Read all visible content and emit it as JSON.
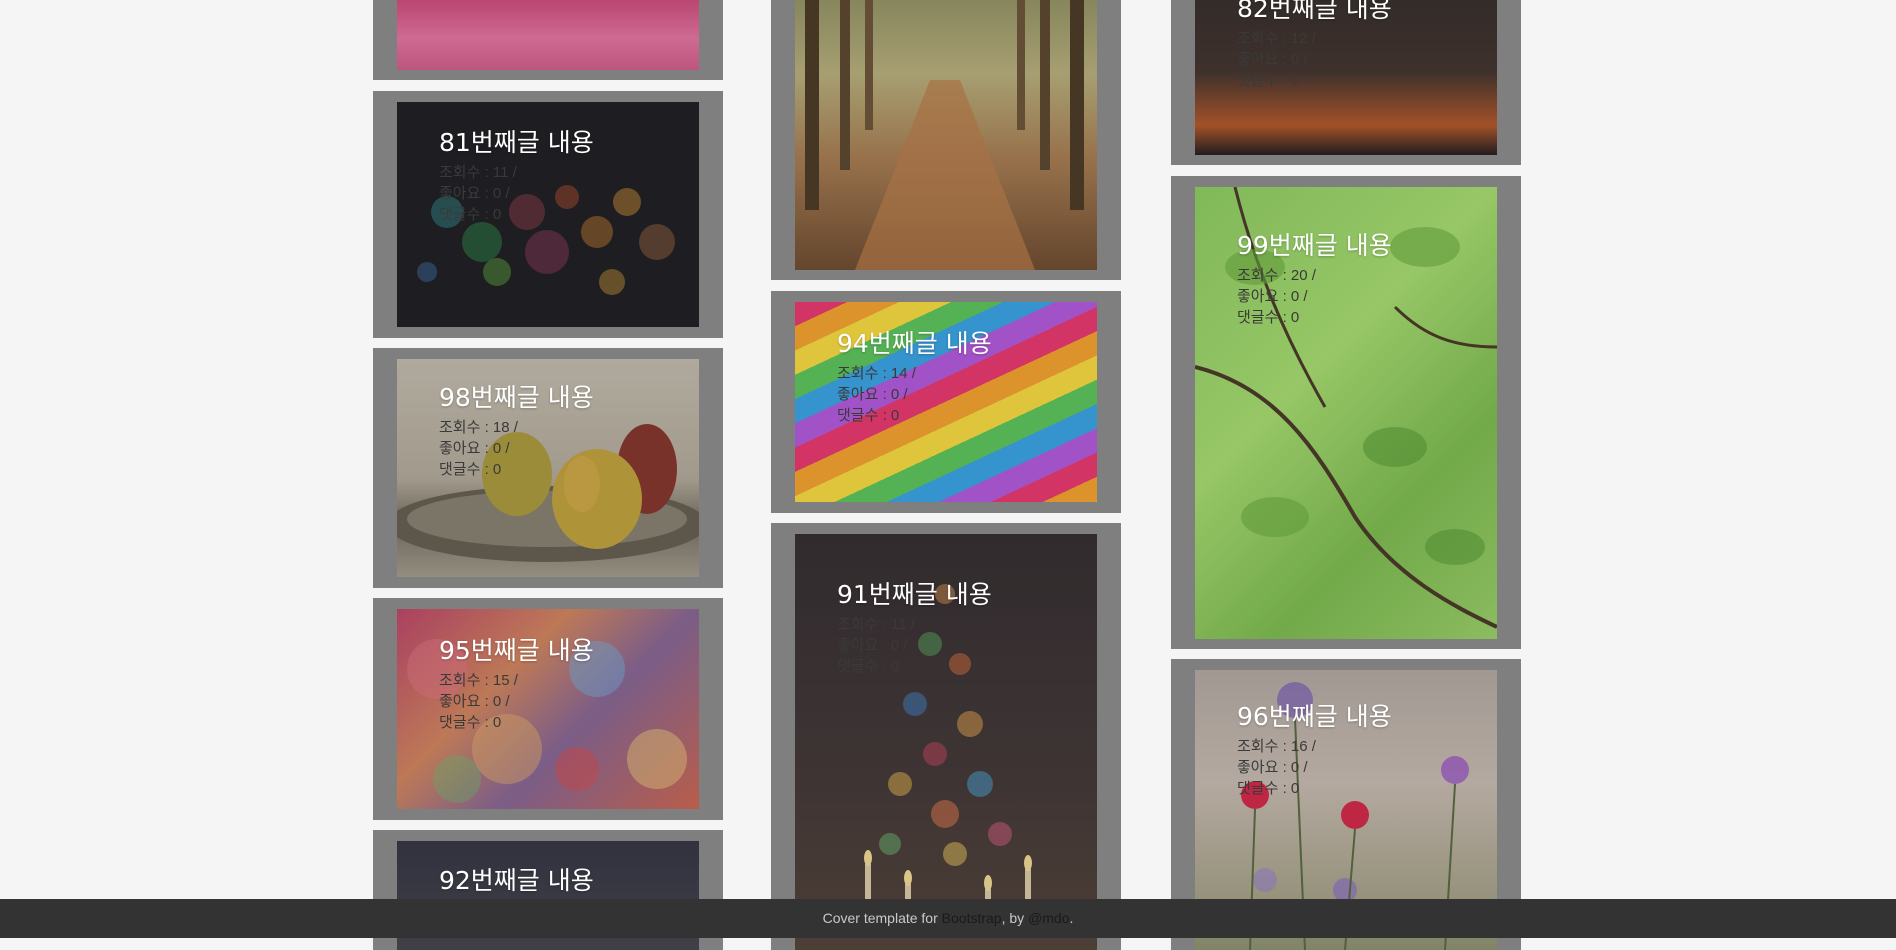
{
  "colors": {
    "page_background": "#f5f5f5",
    "card_border": "#7f7f7f",
    "title_text": "#ffffff",
    "stat_text": "#3a3a3a",
    "footer_background": "#333333",
    "footer_text": "#c9c9c9"
  },
  "posts": {
    "p81": {
      "title": "81번째글 내용",
      "views": "조회수 : 11 /",
      "likes": "좋아요 : 0 /",
      "comments": "댓글수 : 0"
    },
    "p98": {
      "title": "98번째글 내용",
      "views": "조회수 : 18 /",
      "likes": "좋아요 : 0 /",
      "comments": "댓글수 : 0"
    },
    "p95": {
      "title": "95번째글 내용",
      "views": "조회수 : 15 /",
      "likes": "좋아요 : 0 /",
      "comments": "댓글수 : 0"
    },
    "p92": {
      "title": "92번째글 내용"
    },
    "p94": {
      "title": "94번째글 내용",
      "views": "조회수 : 14 /",
      "likes": "좋아요 : 0 /",
      "comments": "댓글수 : 0"
    },
    "p91": {
      "title": "91번째글 내용",
      "views": "조회수 : 11 /",
      "likes": "좋아요 : 0 /",
      "comments": "댓글수 : 0"
    },
    "p82": {
      "title": "82번째글 내용",
      "views": "조회수 : 12 /",
      "likes": "좋아요 : 0 /",
      "comments": "댓글수 : 0"
    },
    "p99": {
      "title": "99번째글 내용",
      "views": "조회수 : 20 /",
      "likes": "좋아요 : 0 /",
      "comments": "댓글수 : 0"
    },
    "p96": {
      "title": "96번째글 내용",
      "views": "조회수 : 16 /",
      "likes": "좋아요 : 0 /",
      "comments": "댓글수 : 0"
    }
  },
  "footer": {
    "prefix": "Cover template for ",
    "bootstrap_link": "Bootstrap",
    "by": ", by ",
    "author_link": "@mdo",
    "suffix": "."
  }
}
